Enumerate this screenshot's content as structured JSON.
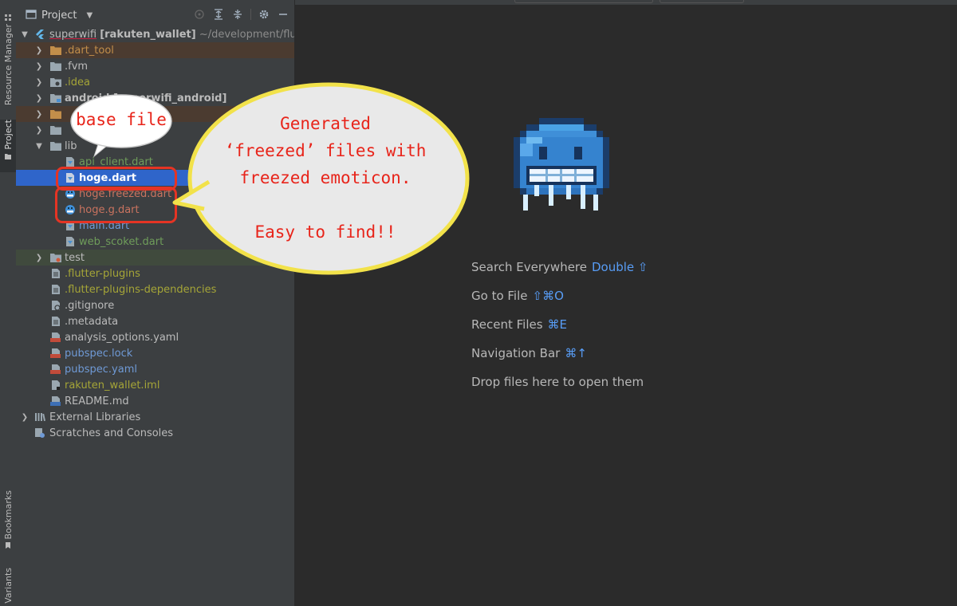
{
  "sidebar_tabs": {
    "resource_manager": "Resource Manager",
    "project": "Project",
    "bookmarks": "Bookmarks",
    "variants": "Variants"
  },
  "panel": {
    "title": "Project",
    "tools": [
      "crosshair-icon",
      "expand-all-icon",
      "collapse-all-icon",
      "gear-icon",
      "minimize-icon"
    ]
  },
  "tree": {
    "root_name": "superwifi",
    "root_module": "[rakuten_wallet]",
    "root_path": "~/development/flutter_",
    "dart_tool": ".dart_tool",
    "fvm": ".fvm",
    "idea": ".idea",
    "android": "android [superwifi_android]",
    "lib": "lib",
    "api_client": "api_client.dart",
    "hoge": "hoge.dart",
    "hoge_freezed": "hoge.freezed.dart",
    "hoge_g": "hoge.g.dart",
    "main": "main.dart",
    "web_scoket": "web_scoket.dart",
    "test": "test",
    "flutter_plugins": ".flutter-plugins",
    "flutter_plugins_deps": ".flutter-plugins-dependencies",
    "gitignore": ".gitignore",
    "metadata": ".metadata",
    "analysis_options": "analysis_options.yaml",
    "pubspec_lock": "pubspec.lock",
    "pubspec_yaml": "pubspec.yaml",
    "rakuten_iml": "rakuten_wallet.iml",
    "readme": "README.md",
    "external_libraries": "External Libraries",
    "scratches": "Scratches and Consoles"
  },
  "editor_hints": [
    {
      "label": "Search Everywhere",
      "key": "Double ⇧"
    },
    {
      "label": "Go to File",
      "key": "⇧⌘O"
    },
    {
      "label": "Recent Files",
      "key": "⌘E"
    },
    {
      "label": "Navigation Bar",
      "key": "⌘↑"
    },
    {
      "label": "Drop files here to open them",
      "key": ""
    }
  ],
  "callouts": {
    "base": "base file",
    "gen_line1": "Generated",
    "gen_line2": "‘freezed’ files with",
    "gen_line3": "freezed emoticon.",
    "gen_line4": "Easy to find!!"
  },
  "colors": {
    "background": "#2b2b2b",
    "panel": "#3c3f41",
    "selection": "#2f65ca",
    "accent_key": "#589df6",
    "callout_text": "#e8241a",
    "callout_border": "#f2e24a",
    "highlight_box": "#e53424"
  },
  "emoticon": "freezing-face-icon"
}
